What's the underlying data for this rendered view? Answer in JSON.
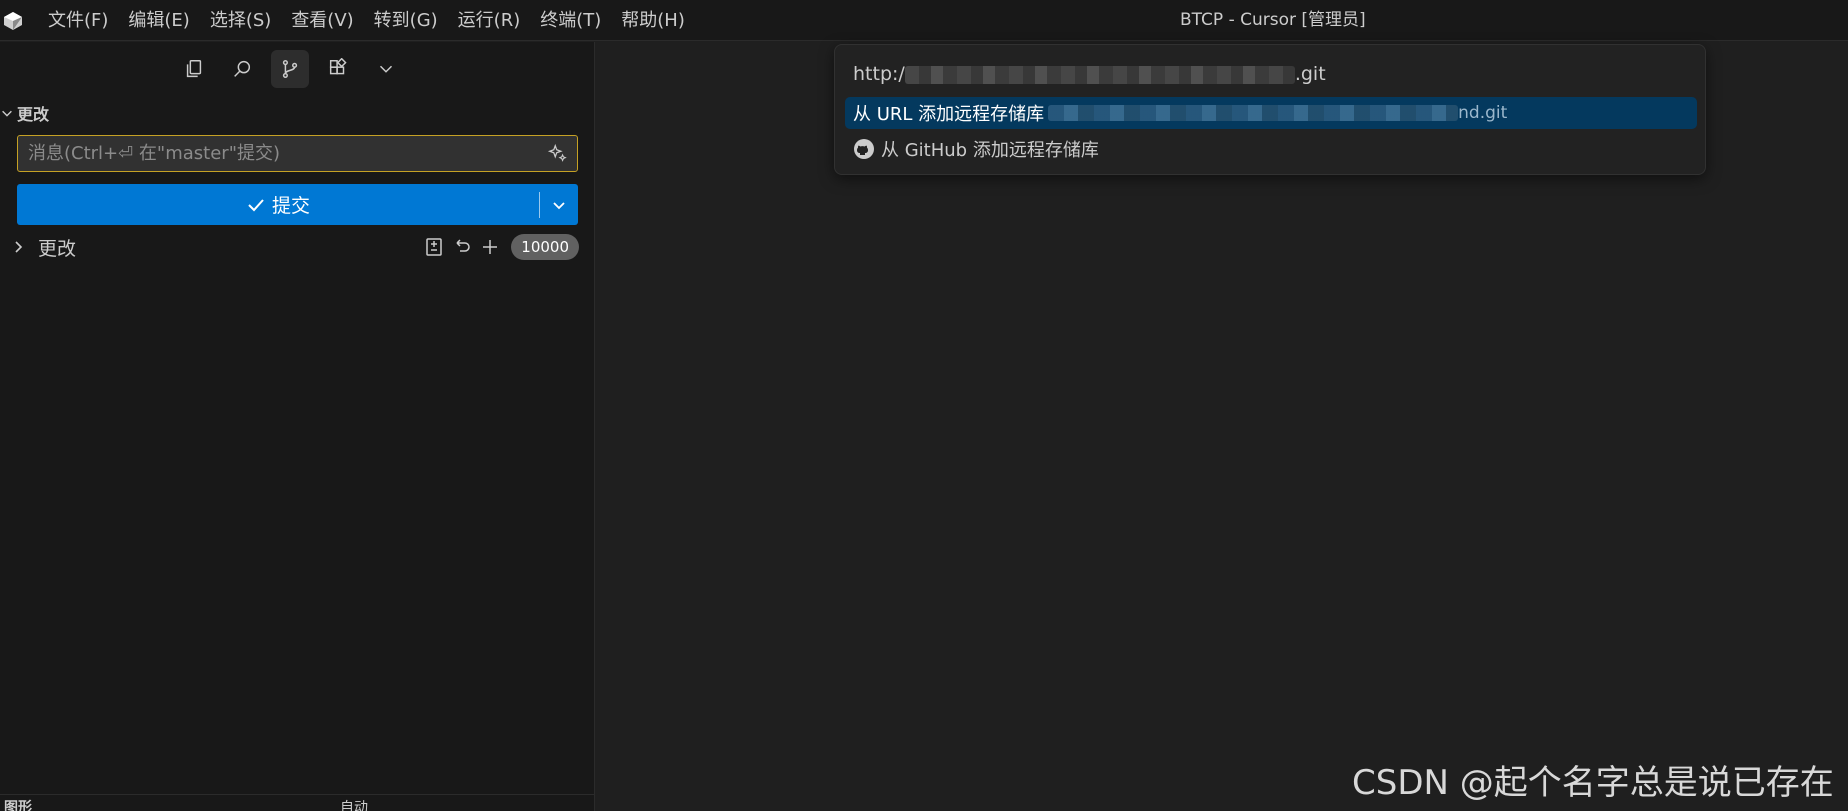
{
  "window": {
    "title": "BTCP - Cursor [管理员]"
  },
  "menu": [
    "文件(F)",
    "编辑(E)",
    "选择(S)",
    "查看(V)",
    "转到(G)",
    "运行(R)",
    "终端(T)",
    "帮助(H)"
  ],
  "activity_bar": {
    "items": [
      "files-icon",
      "search-icon",
      "source-control-icon",
      "extensions-icon",
      "chevron-down-icon"
    ],
    "active": "source-control-icon"
  },
  "scm": {
    "section_title": "更改",
    "commit_placeholder": "消息(Ctrl+⏎ 在\"master\"提交)",
    "commit_button_label": "提交",
    "changes_label": "更改",
    "changes_count": "10000",
    "graph_title": "图形",
    "graph_tools": [
      "自动"
    ]
  },
  "quickpick": {
    "input_prefix": "http:/",
    "input_suffix": ".git",
    "items": [
      {
        "label": "从 URL 添加远程存储库",
        "description_suffix": "nd.git",
        "selected": true,
        "icon": ""
      },
      {
        "label": "从 GitHub 添加远程存储库",
        "description_suffix": "",
        "selected": false,
        "icon": "github-icon"
      }
    ]
  },
  "watermark": "CSDN @起个名字总是说已存在",
  "colors": {
    "accent": "#0078d4",
    "selection": "#04395e",
    "input_border": "#c5a124"
  }
}
